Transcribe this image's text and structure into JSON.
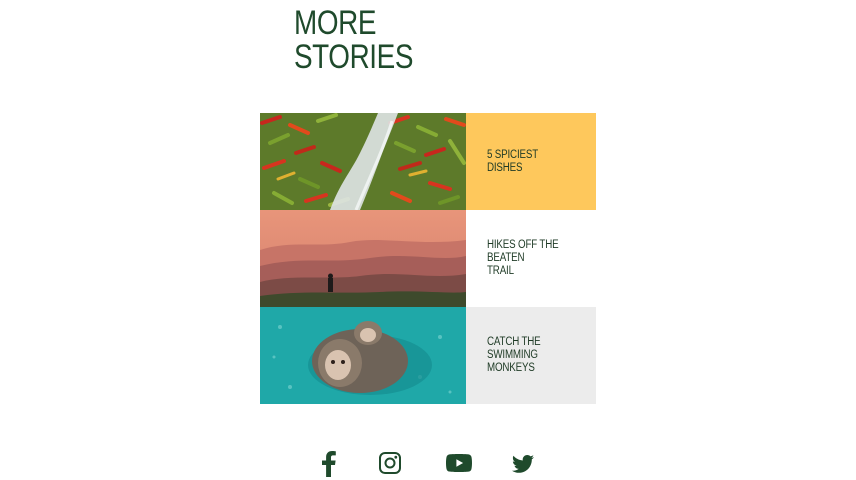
{
  "section": {
    "title_line1": "MORE",
    "title_line2": "STORIES"
  },
  "stories": [
    {
      "label": "5 SPICIEST\nDISHES",
      "panel_color": "#fec85c",
      "image": "chili-peppers-photo"
    },
    {
      "label": "HIKES OFF THE\nBEATEN\nTRAIL",
      "panel_color": "#ffffff",
      "image": "mountain-hiker-photo"
    },
    {
      "label": "CATCH THE\nSWIMMING\nMONKEYS",
      "panel_color": "#ececec",
      "image": "swimming-monkeys-photo"
    }
  ],
  "social": [
    {
      "name": "facebook",
      "icon": "facebook-icon"
    },
    {
      "name": "instagram",
      "icon": "instagram-icon"
    },
    {
      "name": "youtube",
      "icon": "youtube-icon"
    },
    {
      "name": "twitter",
      "icon": "twitter-icon"
    }
  ],
  "colors": {
    "brand_green": "#1f4a2c",
    "accent_yellow": "#fec85c"
  }
}
